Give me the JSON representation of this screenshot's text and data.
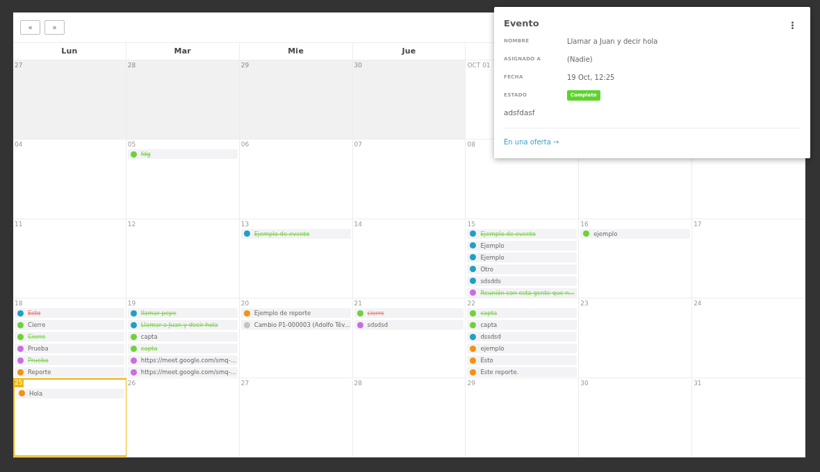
{
  "nav_buttons": [
    "«",
    "»"
  ],
  "day_headers": [
    "Lun",
    "Mar",
    "Mie",
    "Jue"
  ],
  "weeks": [
    [
      {
        "day": "27",
        "outside_month": true
      },
      {
        "day": "28",
        "outside_month": true
      },
      {
        "day": "29",
        "outside_month": true
      },
      {
        "day": "30",
        "outside_month": true
      },
      {
        "day": "OCT 01",
        "outside_month": false
      }
    ],
    [
      {
        "day": "04",
        "outside_month": false
      },
      {
        "day": "05",
        "outside_month": false,
        "events": [
          {
            "title": "fdg",
            "color": "#6fd13a",
            "done": true,
            "overdue": false
          }
        ]
      },
      {
        "day": "06",
        "outside_month": false
      },
      {
        "day": "07",
        "outside_month": false
      },
      {
        "day": "08",
        "outside_month": false
      }
    ],
    [
      {
        "day": "11",
        "outside_month": false
      },
      {
        "day": "12",
        "outside_month": false
      },
      {
        "day": "13",
        "outside_month": false,
        "events": [
          {
            "title": "Ejemplo de evento",
            "color": "#1ea0c8",
            "done": true,
            "overdue": false
          }
        ]
      },
      {
        "day": "14",
        "outside_month": false
      },
      {
        "day": "15",
        "outside_month": false,
        "events": [
          {
            "title": "Ejemplo de evento",
            "color": "#1ea0c8",
            "done": true,
            "overdue": false
          },
          {
            "title": "Ejemplo",
            "color": "#1ea0c8",
            "done": false,
            "overdue": false
          },
          {
            "title": "Ejemplo",
            "color": "#1ea0c8",
            "done": false,
            "overdue": false
          },
          {
            "title": "Otro",
            "color": "#1ea0c8",
            "done": false,
            "overdue": false
          },
          {
            "title": "sdsdds",
            "color": "#1ea0c8",
            "done": false,
            "overdue": false
          },
          {
            "title": "Reunión con esta gente que n...",
            "color": "#c86ee0",
            "done": true,
            "overdue": false
          }
        ]
      },
      {
        "day": "16",
        "outside_month": false,
        "events": [
          {
            "title": "ejemplo",
            "color": "#6fd13a",
            "done": false,
            "overdue": false
          }
        ]
      },
      {
        "day": "17",
        "outside_month": false
      }
    ],
    [
      {
        "day": "18",
        "outside_month": false,
        "events": [
          {
            "title": "Esto",
            "color": "#1ea0c8",
            "done": false,
            "overdue": true
          },
          {
            "title": "Cierre",
            "color": "#6fd13a",
            "done": false,
            "overdue": false
          },
          {
            "title": "Cierre",
            "color": "#6fd13a",
            "done": true,
            "overdue": false
          },
          {
            "title": "Prueba",
            "color": "#c86ee0",
            "done": false,
            "overdue": false
          },
          {
            "title": "Prueba",
            "color": "#c86ee0",
            "done": true,
            "overdue": false
          },
          {
            "title": "Reporte",
            "color": "#f6900f",
            "done": false,
            "overdue": false
          }
        ]
      },
      {
        "day": "19",
        "outside_month": false,
        "events": [
          {
            "title": "llamar pepe",
            "color": "#1ea0c8",
            "done": true,
            "overdue": false
          },
          {
            "title": "Llamar a Juan y decir hola",
            "color": "#1ea0c8",
            "done": true,
            "overdue": false
          },
          {
            "title": "capta",
            "color": "#6fd13a",
            "done": false,
            "overdue": false
          },
          {
            "title": "capta",
            "color": "#6fd13a",
            "done": true,
            "overdue": false
          },
          {
            "title": "https://meet.google.com/smq-...",
            "color": "#c86ee0",
            "done": false,
            "overdue": false
          },
          {
            "title": "https://meet.google.com/smq-...",
            "color": "#c86ee0",
            "done": false,
            "overdue": false
          }
        ]
      },
      {
        "day": "20",
        "outside_month": false,
        "events": [
          {
            "title": "Ejemplo de reporte",
            "color": "#f6900f",
            "done": false,
            "overdue": false
          },
          {
            "title": "Cambio P1-000003 (Adolfo Tév...",
            "color": "#c4c4c4",
            "done": false,
            "overdue": false
          }
        ]
      },
      {
        "day": "21",
        "outside_month": false,
        "events": [
          {
            "title": "cierre",
            "color": "#6fd13a",
            "done": false,
            "overdue": true
          },
          {
            "title": "sdsdsd",
            "color": "#c86ee0",
            "done": false,
            "overdue": false
          }
        ]
      },
      {
        "day": "22",
        "outside_month": false,
        "events": [
          {
            "title": "capta",
            "color": "#6fd13a",
            "done": true,
            "overdue": false
          },
          {
            "title": "capta",
            "color": "#6fd13a",
            "done": false,
            "overdue": false
          },
          {
            "title": "dssdsd",
            "color": "#1ea0c8",
            "done": false,
            "overdue": false
          },
          {
            "title": "ejemplo",
            "color": "#f6900f",
            "done": false,
            "overdue": false
          },
          {
            "title": "Esto",
            "color": "#f6900f",
            "done": false,
            "overdue": false
          },
          {
            "title": "Este reporte.",
            "color": "#f6900f",
            "done": false,
            "overdue": false
          }
        ]
      },
      {
        "day": "23",
        "outside_month": false
      },
      {
        "day": "24",
        "outside_month": false
      }
    ],
    [
      {
        "day": "25",
        "outside_month": false,
        "today": true,
        "events": [
          {
            "title": "Hola",
            "color": "#f6900f",
            "done": false,
            "overdue": false
          }
        ]
      },
      {
        "day": "26",
        "outside_month": false
      },
      {
        "day": "27",
        "outside_month": false
      },
      {
        "day": "28",
        "outside_month": false
      },
      {
        "day": "29",
        "outside_month": false
      },
      {
        "day": "30",
        "outside_month": false
      },
      {
        "day": "31",
        "outside_month": false
      }
    ]
  ],
  "event_popup": {
    "title": "Evento",
    "fields": [
      {
        "label": "NOMBRE",
        "value": "Llamar a Juan y decir hola"
      },
      {
        "label": "ASIGNADO A",
        "value": "(Nadie)"
      },
      {
        "label": "FECHA",
        "value": "19 Oct, 12:25"
      },
      {
        "label": "ESTADO",
        "badge": "Completo"
      }
    ],
    "description": "adsfdasf",
    "link": "En una oferta →"
  }
}
